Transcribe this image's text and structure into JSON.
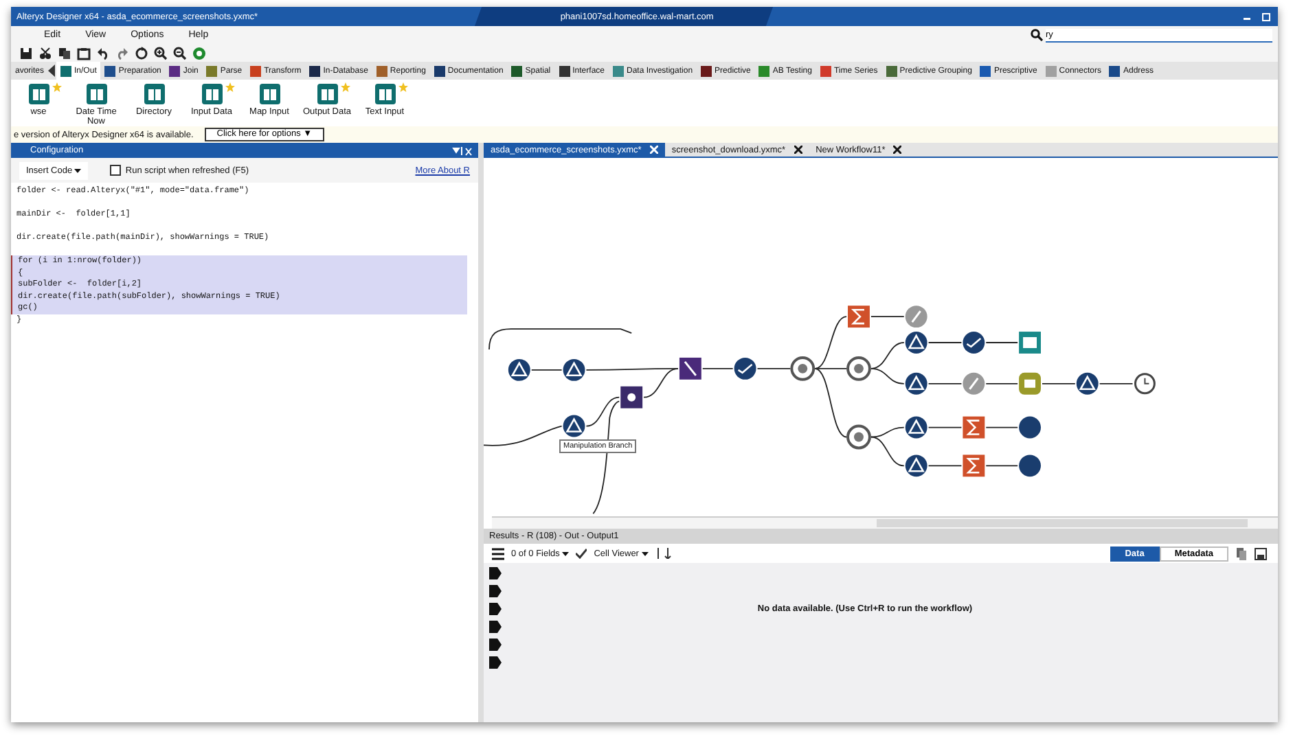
{
  "window": {
    "title": "Alteryx Designer x64 - asda_ecommerce_screenshots.yxmc*",
    "remote_host": "phani1007sd.homeoffice.wal-mart.com"
  },
  "menu": [
    "Edit",
    "View",
    "Options",
    "Help"
  ],
  "search": {
    "value": "ry"
  },
  "palette_tabs": [
    {
      "label": "avorites",
      "selected": false
    },
    {
      "label": "In/Out",
      "selected": true,
      "color": "#0f6e6e"
    },
    {
      "label": "Preparation",
      "selected": false,
      "color": "#1f4e8c"
    },
    {
      "label": "Join",
      "selected": false,
      "color": "#5b2c83"
    },
    {
      "label": "Parse",
      "selected": false,
      "color": "#7a7a2a"
    },
    {
      "label": "Transform",
      "selected": false,
      "color": "#c8401e"
    },
    {
      "label": "In-Database",
      "selected": false,
      "color": "#1c2a4a"
    },
    {
      "label": "Reporting",
      "selected": false,
      "color": "#a0602a"
    },
    {
      "label": "Documentation",
      "selected": false,
      "color": "#1a3a6a"
    },
    {
      "label": "Spatial",
      "selected": false,
      "color": "#1e5a2a"
    },
    {
      "label": "Interface",
      "selected": false,
      "color": "#333333"
    },
    {
      "label": "Data Investigation",
      "selected": false,
      "color": "#3a8a8a"
    },
    {
      "label": "Predictive",
      "selected": false,
      "color": "#6a1a1a"
    },
    {
      "label": "AB Testing",
      "selected": false,
      "color": "#2a8a2a"
    },
    {
      "label": "Time Series",
      "selected": false,
      "color": "#d03a2a"
    },
    {
      "label": "Predictive Grouping",
      "selected": false,
      "color": "#4a6a3a"
    },
    {
      "label": "Prescriptive",
      "selected": false,
      "color": "#1a5ab0"
    },
    {
      "label": "Connectors",
      "selected": false,
      "color": "#a0a0a0"
    },
    {
      "label": "Address",
      "selected": false,
      "color": "#1a4a8a"
    }
  ],
  "tools": [
    {
      "label": "wse",
      "favorite": true
    },
    {
      "label": "Date Time Now",
      "favorite": false
    },
    {
      "label": "Directory",
      "favorite": false
    },
    {
      "label": "Input Data",
      "favorite": true
    },
    {
      "label": "Map Input",
      "favorite": false
    },
    {
      "label": "Output Data",
      "favorite": true
    },
    {
      "label": "Text Input",
      "favorite": true
    }
  ],
  "update_bar": {
    "message": "e version of Alteryx Designer x64 is available.",
    "button": "Click here for options ▼"
  },
  "configuration": {
    "title": "Configuration",
    "insert_code": "Insert Code",
    "run_script_checkbox": {
      "label": "Run script when refreshed (F5)",
      "checked": false
    },
    "link": "More About R",
    "code_lines": [
      {
        "kind": "code",
        "text": "folder <- read.Alteryx(\"#1\", mode=\"data.frame\")",
        "selected": false
      },
      {
        "kind": "blank",
        "selected": false
      },
      {
        "kind": "code",
        "text": "mainDir <-  folder[1,1]",
        "selected": false
      },
      {
        "kind": "blank",
        "selected": false
      },
      {
        "kind": "code",
        "text": "dir.create(file.path(mainDir), showWarnings = TRUE)",
        "selected": false
      },
      {
        "kind": "blank",
        "selected": false
      },
      {
        "kind": "code",
        "text": "for (i in 1:nrow(folder))",
        "selected": true
      },
      {
        "kind": "code",
        "text": "{",
        "selected": true
      },
      {
        "kind": "code",
        "text": "subFolder <-  folder[i,2]",
        "selected": true
      },
      {
        "kind": "code",
        "text": "dir.create(file.path(subFolder), showWarnings = TRUE)",
        "selected": true
      },
      {
        "kind": "code",
        "text": "gc()",
        "selected": true
      },
      {
        "kind": "code",
        "text": "}",
        "selected": false
      }
    ]
  },
  "doc_tabs": [
    {
      "label": "asda_ecommerce_screenshots.yxmc*",
      "selected": true
    },
    {
      "label": "screenshot_download.yxmc*",
      "selected": false
    },
    {
      "label": "New Workflow11*",
      "selected": false
    }
  ],
  "canvas": {
    "comment": "Manipulation Branch"
  },
  "results": {
    "title": "Results - R (108) - Out - Output1",
    "fields": "0 of 0 Fields",
    "viewer": "Cell Viewer",
    "view_buttons": [
      {
        "label": "Data",
        "selected": true
      },
      {
        "label": "Metadata",
        "selected": false
      }
    ],
    "message": "No data available. (Use Ctrl+R to run the workflow)"
  }
}
